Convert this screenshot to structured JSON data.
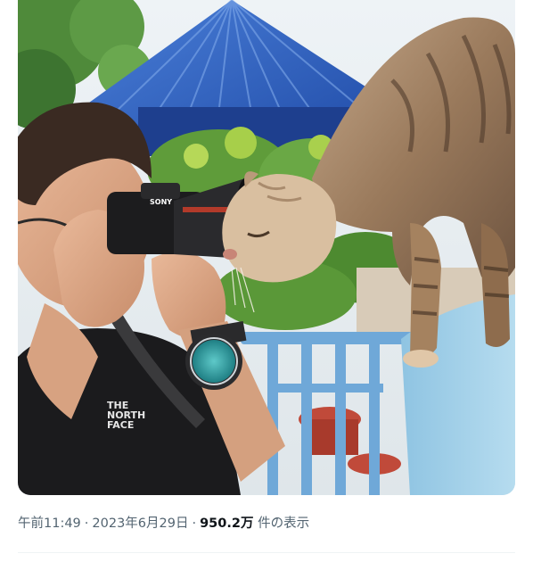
{
  "tweet": {
    "time": "午前11:49",
    "separator": "·",
    "date": "2023年6月29日",
    "views_count": "950.2万",
    "views_label": "件の表示"
  },
  "photo": {
    "camera_brand": "SONY",
    "shirt_logo_line1": "THE",
    "shirt_logo_line2": "NORTH",
    "shirt_logo_line3": "FACE"
  },
  "colors": {
    "meta_text": "#536471",
    "strong_text": "#0f1419",
    "roof_blue": "#2f5fc0",
    "railing_blue": "#6fa8d8",
    "watch_face": "#35a6a8"
  }
}
